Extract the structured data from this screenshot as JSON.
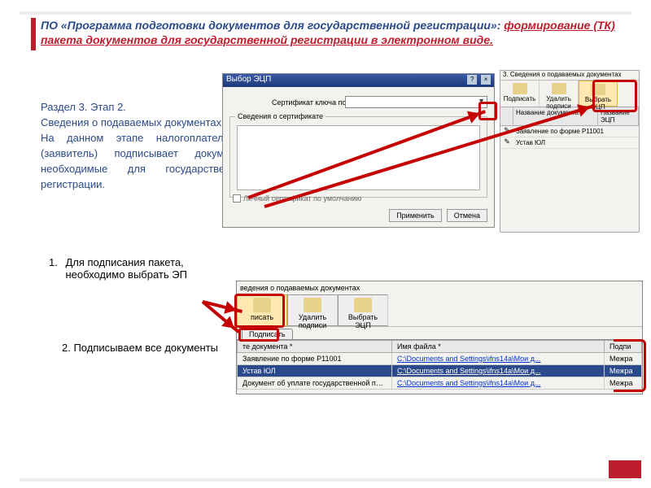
{
  "title": {
    "line1": "ПО «Программа подготовки документов для государственной регистрации»: ",
    "line2": "формирование (ТК) пакета документов для государственной регистрации в электронном виде."
  },
  "left_text": {
    "l1": "Раздел 3. Этап 2.",
    "l2": "Сведения о подаваемых документах.",
    "l3": "На данном этапе налогоплательщик (заявитель) подписывает документы необходимые для государственной регистрации."
  },
  "steps": {
    "one_num": "1.",
    "one": "Для подписания пакета, необходимо выбрать ЭП",
    "two": "2. Подписываем все документы"
  },
  "dlg_cert": {
    "title": "Выбор ЭЦП",
    "cert_label": "Сертификат ключа подписи",
    "group_label": "Сведения о сертификате",
    "checkbox": "Личный сертификат по умолчанию",
    "btn_apply": "Применить",
    "btn_cancel": "Отмена"
  },
  "pane_small": {
    "header": "3. Сведения о подаваемых документах",
    "tb_sign": "Подписать",
    "tb_delete": "Удалить подписи",
    "tb_select": "Выбрать ЭЦП",
    "col_name": "Название документа",
    "col_ecp": "Название ЭЦП",
    "row1": "Заявление по форме Р11001",
    "row2": "Устав ЮЛ"
  },
  "dlg_docs": {
    "caption": "ведения о подаваемых документах",
    "tb_sign": "писать",
    "tb_delete": "Удалить подписи",
    "tb_select": "Выбрать ЭЦП",
    "tab": "Подписать",
    "col1": "те документа *",
    "col2": "Имя файла *",
    "col3": "Подпи",
    "rows": [
      {
        "name": "Заявление по форме Р11001",
        "file": "C:\\Documents and Settings\\ifns14a\\Мои д...",
        "sig": "Межра"
      },
      {
        "name": "Устав ЮЛ",
        "file": "C:\\Documents and Settings\\ifns14a\\Мои д...",
        "sig": "Межра"
      },
      {
        "name": "Документ об уплате государственной пошлины",
        "file": "C:\\Documents and Settings\\ifns14a\\Мои д...",
        "sig": "Межра"
      }
    ]
  }
}
